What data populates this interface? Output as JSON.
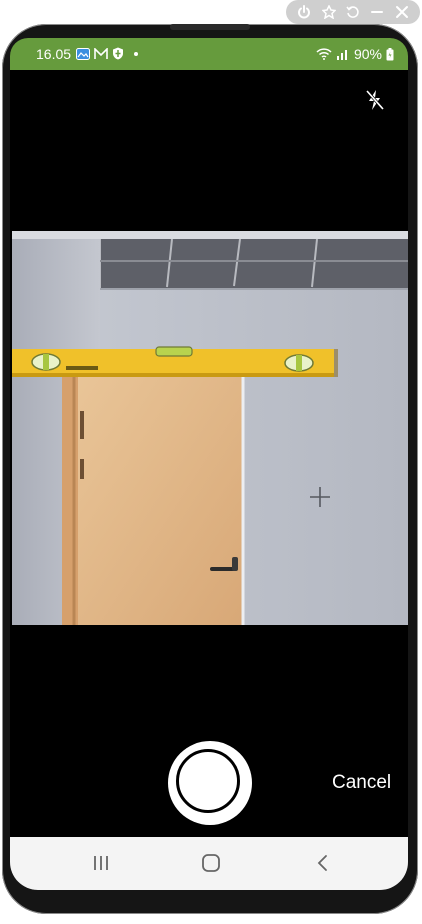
{
  "emulator_toolbar": {
    "icons": [
      "power-icon",
      "pin-icon",
      "rotate-icon",
      "minimize-icon",
      "close-icon"
    ]
  },
  "status_bar": {
    "time": "16.05",
    "battery": "90%",
    "background_color": "#669b3d"
  },
  "camera": {
    "flash_state": "flash-off-icon",
    "cancel_label": "Cancel"
  },
  "nav_bar": {
    "icons": [
      "recents-icon",
      "home-icon",
      "back-icon"
    ]
  }
}
